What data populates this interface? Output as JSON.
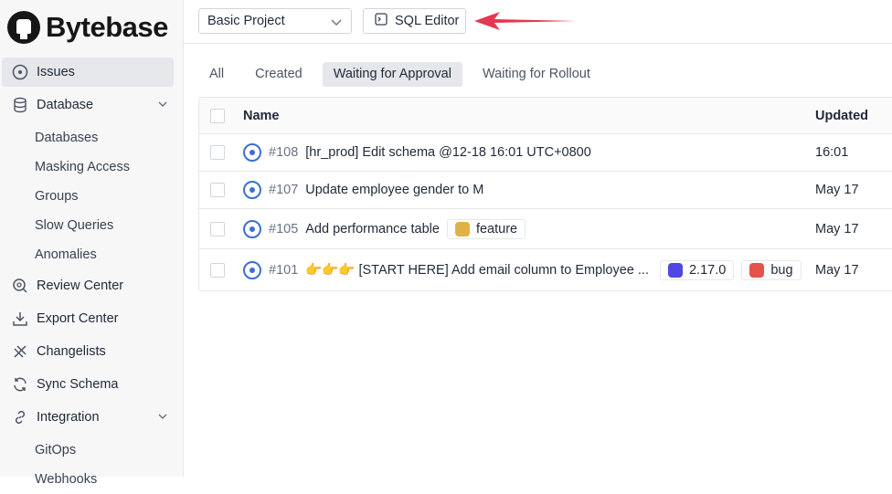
{
  "app": {
    "logo_text": "Bytebase"
  },
  "sidebar": {
    "items": [
      {
        "label": "Issues",
        "icon": "issues-icon",
        "active": true
      },
      {
        "label": "Database",
        "icon": "database-icon",
        "expandable": true
      },
      {
        "label": "Databases"
      },
      {
        "label": "Masking Access"
      },
      {
        "label": "Groups"
      },
      {
        "label": "Slow Queries"
      },
      {
        "label": "Anomalies"
      },
      {
        "label": "Review Center",
        "icon": "review-icon"
      },
      {
        "label": "Export Center",
        "icon": "download-icon"
      },
      {
        "label": "Changelists",
        "icon": "changelist-icon"
      },
      {
        "label": "Sync Schema",
        "icon": "sync-icon"
      },
      {
        "label": "Integration",
        "icon": "link-icon",
        "expandable": true
      },
      {
        "label": "GitOps"
      },
      {
        "label": "Webhooks"
      }
    ]
  },
  "topbar": {
    "project_select_value": "Basic Project",
    "sql_editor_label": "SQL Editor"
  },
  "tabs": [
    "All",
    "Created",
    "Waiting for Approval",
    "Waiting for Rollout"
  ],
  "table": {
    "headers": {
      "name": "Name",
      "updated": "Updated"
    },
    "rows": [
      {
        "num": "#108",
        "title": "[hr_prod] Edit schema @12-18 16:01 UTC+0800",
        "updated": "16:01",
        "labels": []
      },
      {
        "num": "#107",
        "title": "Update employee gender to M",
        "updated": "May 17",
        "labels": []
      },
      {
        "num": "#105",
        "title": "Add performance table",
        "updated": "May 17",
        "labels": [
          {
            "text": "feature",
            "color": "#e0b245"
          }
        ]
      },
      {
        "num": "#101",
        "title": "👉👉👉 [START HERE] Add email column to Employee ...",
        "updated": "May 17",
        "labels": [
          {
            "text": "2.17.0",
            "color": "#4f46e5"
          },
          {
            "text": "bug",
            "color": "#e5534b"
          }
        ]
      }
    ]
  },
  "colors": {
    "accent": "#3b6fd0",
    "arrow": "#e5374f"
  }
}
